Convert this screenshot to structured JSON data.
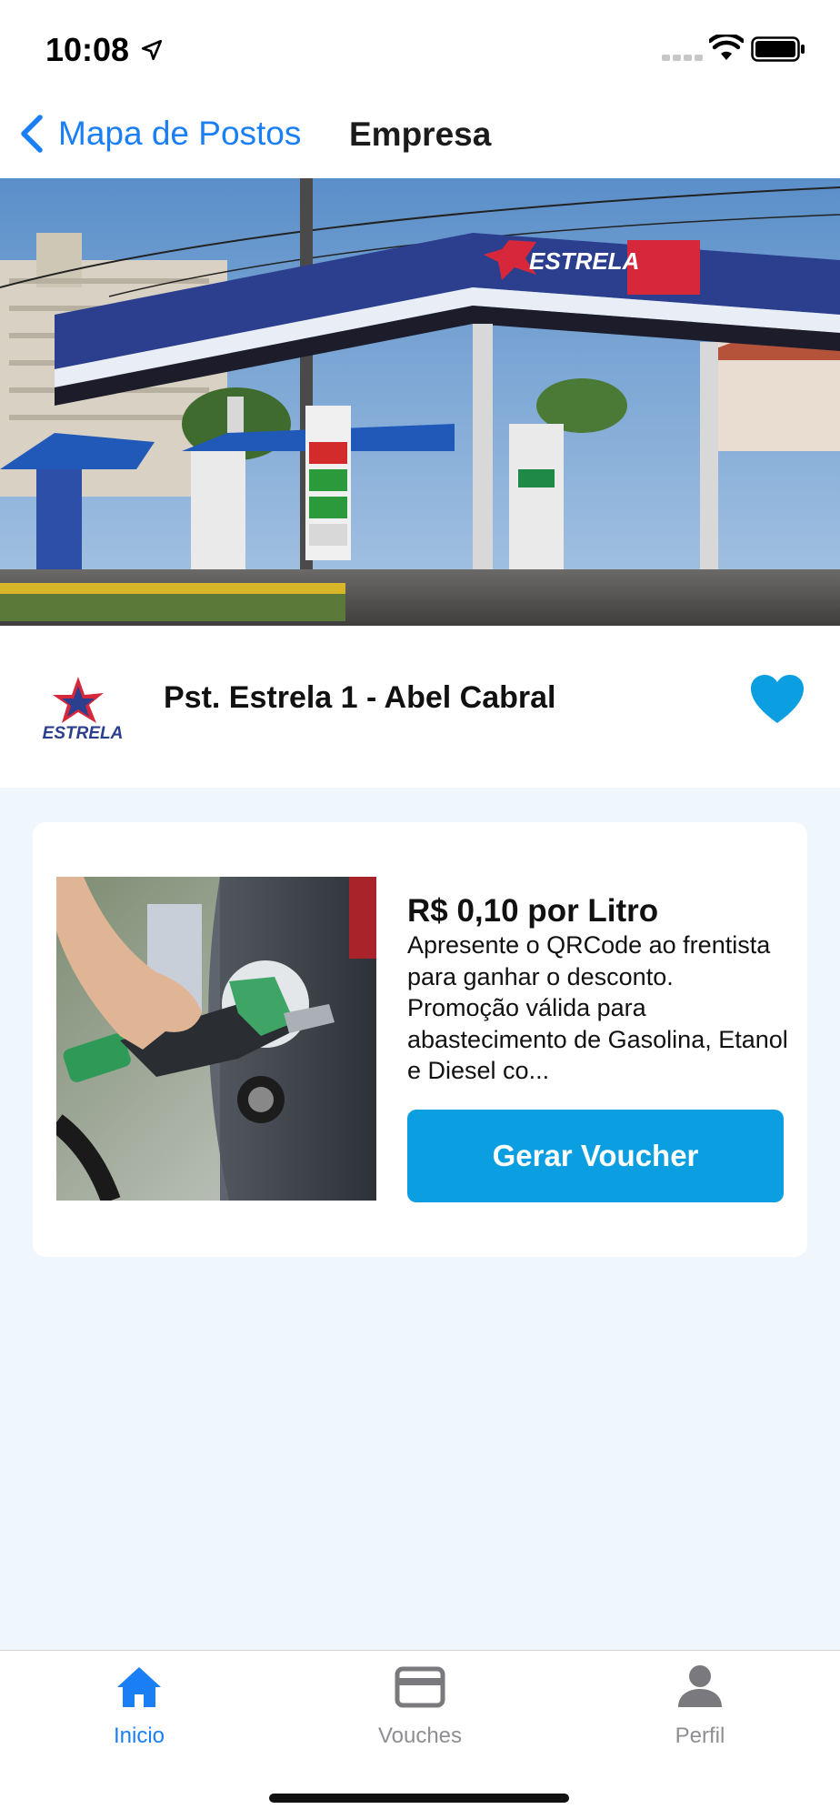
{
  "status_bar": {
    "time": "10:08"
  },
  "nav": {
    "back_label": "Mapa de Postos",
    "title": "Empresa"
  },
  "company": {
    "name": "Pst. Estrela 1 - Abel Cabral",
    "logo_text": "ESTRELA",
    "favorited": true
  },
  "promo": {
    "title": "R$ 0,10 por Litro",
    "description": "Apresente o QRCode ao frentista para ganhar o desconto. Promoção válida para abastecimento de Gasolina, Etanol e Diesel co...",
    "button_label": "Gerar Voucher"
  },
  "tabs": [
    {
      "label": "Inicio",
      "icon": "home-icon",
      "active": true
    },
    {
      "label": "Vouches",
      "icon": "card-icon",
      "active": false
    },
    {
      "label": "Perfil",
      "icon": "person-icon",
      "active": false
    }
  ],
  "colors": {
    "accent": "#1a7ff5",
    "button": "#0b9fe2",
    "heart": "#0b9fe2",
    "background": "#eff7fd"
  }
}
